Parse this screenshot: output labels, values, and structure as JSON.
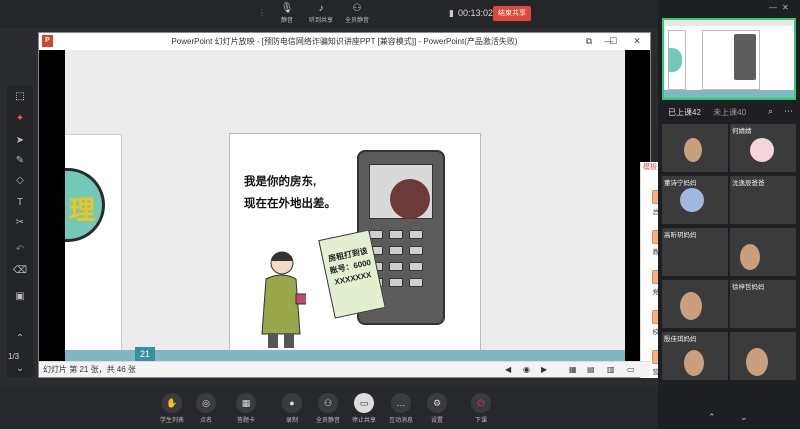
{
  "topbar": {
    "buttons": [
      {
        "label": "静音",
        "icon": "mic-icon"
      },
      {
        "label": "听到共享",
        "icon": "speaker-icon"
      },
      {
        "label": "全员静音",
        "icon": "mute-all-icon"
      }
    ],
    "timer": "00:13:02",
    "end_share": "结束共享"
  },
  "ppt": {
    "title": "PowerPoint 幻灯片放映 - [预防电信网络诈骗知识讲座PPT [兼容模式]] - PowerPoint(产品激活失败)",
    "slide": {
      "speech_line1": "我是你的房东,",
      "speech_line2": "现在在外地出差。",
      "note_line1": "房租打到该",
      "note_line2": "账号：6000",
      "note_line3": "XXXXXXX",
      "left_char": "理"
    },
    "page_badge": "21",
    "template_panel": {
      "title": "模板",
      "items": [
        "总结",
        "教育",
        "党政",
        "校园",
        "营销"
      ]
    },
    "status": "幻灯片 第 21 张，共 46 张"
  },
  "left_toolbar": {
    "page": "1/3"
  },
  "bottombar": {
    "buttons": [
      "学生列表",
      "点名",
      "答题卡",
      "录制",
      "全员静音",
      "停止共享",
      "互动消息",
      "设置",
      "下课"
    ]
  },
  "right_panel": {
    "tabs": {
      "in_class": "已上课42",
      "not_in_class": "未上课40"
    },
    "participants": [
      "",
      "何婧婧",
      "董诗宁妈妈",
      "沈逸辰爸爸",
      "高昕玥妈妈",
      "",
      "",
      "徐梓哲妈妈",
      "殷佳琪妈妈",
      ""
    ]
  }
}
